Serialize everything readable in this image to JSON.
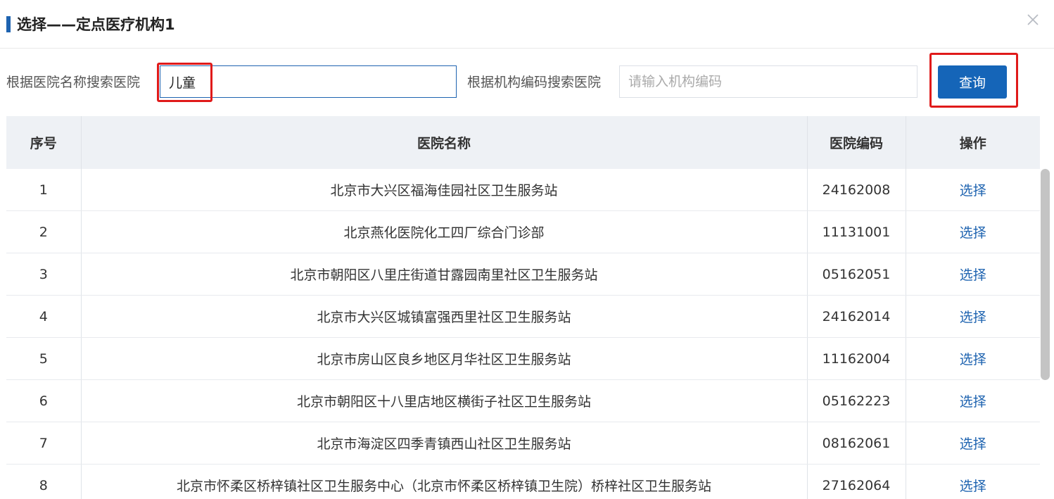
{
  "dialog": {
    "title": "选择——定点医疗机构1"
  },
  "search": {
    "name_label": "根据医院名称搜索医院",
    "name_value": "儿童",
    "code_label": "根据机构编码搜索医院",
    "code_placeholder": "请输入机构编码",
    "code_value": "",
    "query_button": "查询"
  },
  "table": {
    "headers": [
      "序号",
      "医院名称",
      "医院编码",
      "操作"
    ],
    "rows": [
      {
        "index": "1",
        "name": "北京市大兴区福海佳园社区卫生服务站",
        "code": "24162008",
        "action": "选择"
      },
      {
        "index": "2",
        "name": "北京燕化医院化工四厂综合门诊部",
        "code": "11131001",
        "action": "选择"
      },
      {
        "index": "3",
        "name": "北京市朝阳区八里庄街道甘露园南里社区卫生服务站",
        "code": "05162051",
        "action": "选择"
      },
      {
        "index": "4",
        "name": "北京市大兴区城镇富强西里社区卫生服务站",
        "code": "24162014",
        "action": "选择"
      },
      {
        "index": "5",
        "name": "北京市房山区良乡地区月华社区卫生服务站",
        "code": "11162004",
        "action": "选择"
      },
      {
        "index": "6",
        "name": "北京市朝阳区十八里店地区横街子社区卫生服务站",
        "code": "05162223",
        "action": "选择"
      },
      {
        "index": "7",
        "name": "北京市海淀区四季青镇西山社区卫生服务站",
        "code": "08162061",
        "action": "选择"
      },
      {
        "index": "8",
        "name": "北京市怀柔区桥梓镇社区卫生服务中心（北京市怀柔区桥梓镇卫生院）桥梓社区卫生服务站",
        "code": "27162064",
        "action": "选择"
      }
    ]
  },
  "colors": {
    "accent": "#1e63b0",
    "button": "#1565b8",
    "highlight": "#e01a1a",
    "header_bg": "#eef1f5"
  },
  "icons": {
    "close": "close-icon"
  }
}
